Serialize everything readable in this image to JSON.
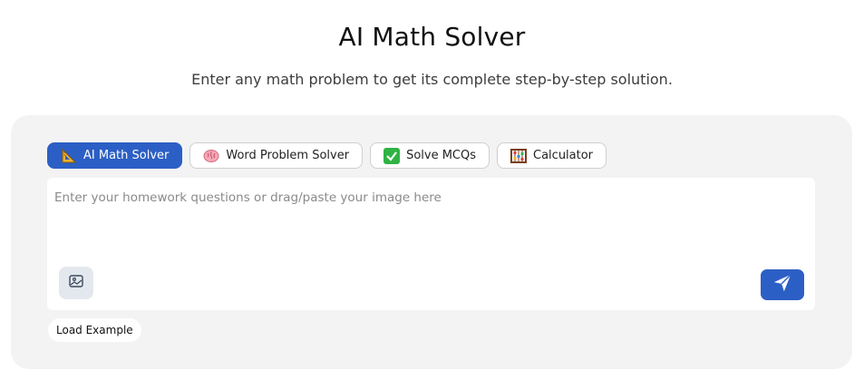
{
  "header": {
    "title": "AI Math Solver",
    "subtitle": "Enter any math problem to get its complete step-by-step solution."
  },
  "tabs": [
    {
      "label": "AI Math Solver",
      "icon": "triangle-ruler-icon",
      "active": true
    },
    {
      "label": "Word Problem Solver",
      "icon": "brain-icon",
      "active": false
    },
    {
      "label": "Solve MCQs",
      "icon": "check-mark-button-icon",
      "active": false
    },
    {
      "label": "Calculator",
      "icon": "abacus-icon",
      "active": false
    }
  ],
  "editor": {
    "placeholder": "Enter your homework questions or drag/paste your image here",
    "value": ""
  },
  "actions": {
    "upload_image_icon": "image-icon",
    "send_icon": "send-icon",
    "load_example_label": "Load Example"
  },
  "colors": {
    "accent": "#2c5fc5",
    "panel_bg": "#f3f3f3",
    "image_button_bg": "#e3e8ee"
  }
}
